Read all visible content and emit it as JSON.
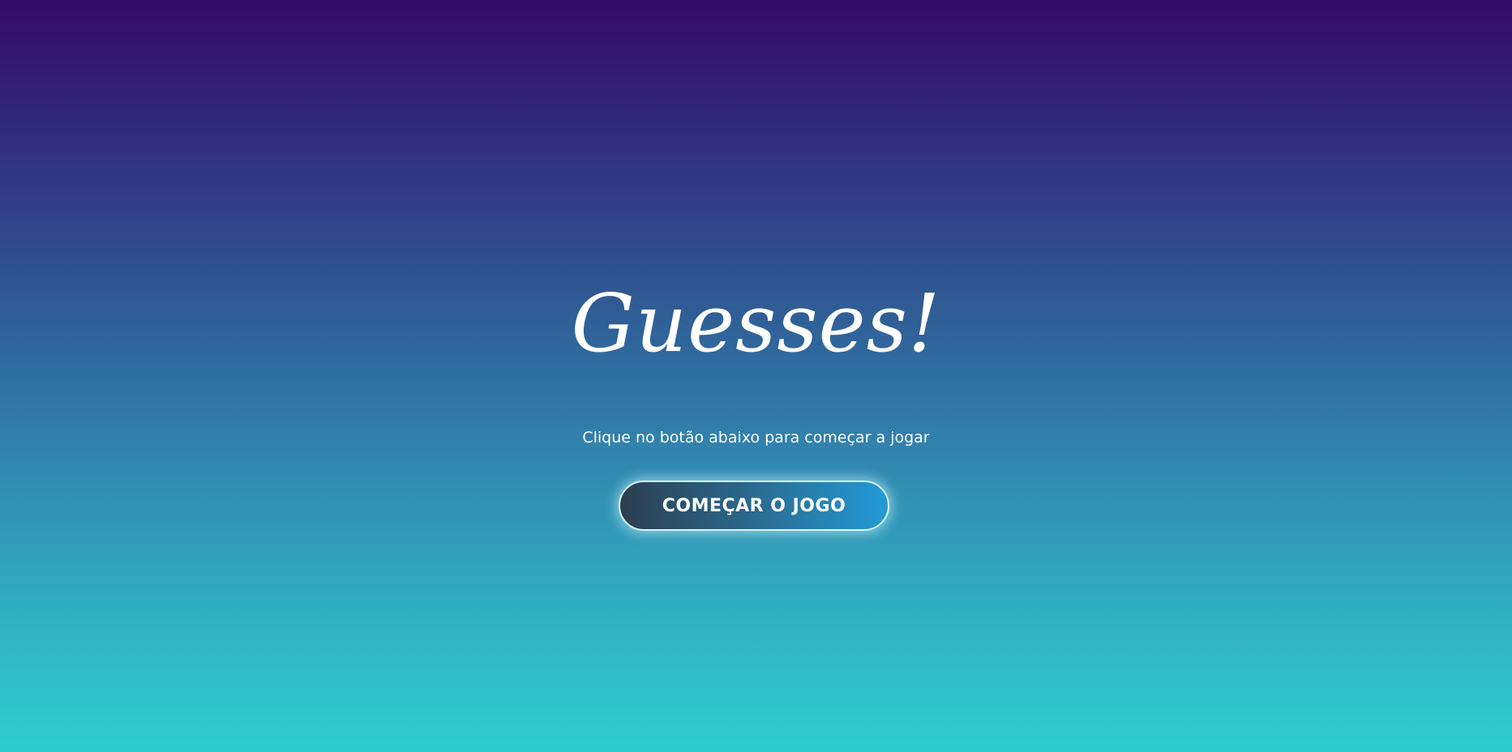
{
  "start_screen": {
    "title": "Guesses!",
    "instruction": "Clique no botão abaixo para começar a jogar",
    "start_button_label": "COMEÇAR O JOGO"
  },
  "colors": {
    "background_top": "#330a6a",
    "background_bottom": "#2fcdcf",
    "button_left": "#2c3e50",
    "button_right": "#239ad6",
    "text": "#ffffff"
  }
}
